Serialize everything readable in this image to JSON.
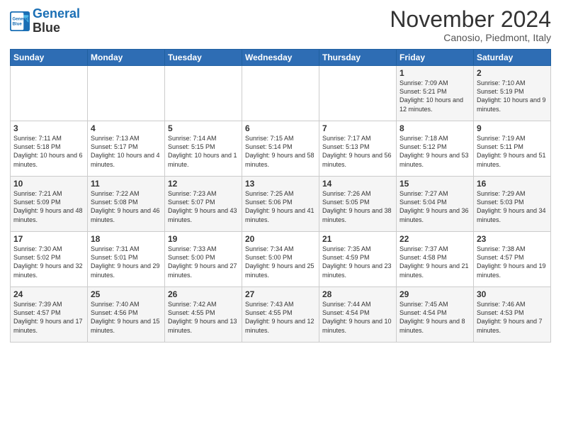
{
  "logo": {
    "line1": "General",
    "line2": "Blue"
  },
  "title": "November 2024",
  "subtitle": "Canosio, Piedmont, Italy",
  "days_of_week": [
    "Sunday",
    "Monday",
    "Tuesday",
    "Wednesday",
    "Thursday",
    "Friday",
    "Saturday"
  ],
  "weeks": [
    [
      {
        "day": "",
        "info": ""
      },
      {
        "day": "",
        "info": ""
      },
      {
        "day": "",
        "info": ""
      },
      {
        "day": "",
        "info": ""
      },
      {
        "day": "",
        "info": ""
      },
      {
        "day": "1",
        "info": "Sunrise: 7:09 AM\nSunset: 5:21 PM\nDaylight: 10 hours and 12 minutes."
      },
      {
        "day": "2",
        "info": "Sunrise: 7:10 AM\nSunset: 5:19 PM\nDaylight: 10 hours and 9 minutes."
      }
    ],
    [
      {
        "day": "3",
        "info": "Sunrise: 7:11 AM\nSunset: 5:18 PM\nDaylight: 10 hours and 6 minutes."
      },
      {
        "day": "4",
        "info": "Sunrise: 7:13 AM\nSunset: 5:17 PM\nDaylight: 10 hours and 4 minutes."
      },
      {
        "day": "5",
        "info": "Sunrise: 7:14 AM\nSunset: 5:15 PM\nDaylight: 10 hours and 1 minute."
      },
      {
        "day": "6",
        "info": "Sunrise: 7:15 AM\nSunset: 5:14 PM\nDaylight: 9 hours and 58 minutes."
      },
      {
        "day": "7",
        "info": "Sunrise: 7:17 AM\nSunset: 5:13 PM\nDaylight: 9 hours and 56 minutes."
      },
      {
        "day": "8",
        "info": "Sunrise: 7:18 AM\nSunset: 5:12 PM\nDaylight: 9 hours and 53 minutes."
      },
      {
        "day": "9",
        "info": "Sunrise: 7:19 AM\nSunset: 5:11 PM\nDaylight: 9 hours and 51 minutes."
      }
    ],
    [
      {
        "day": "10",
        "info": "Sunrise: 7:21 AM\nSunset: 5:09 PM\nDaylight: 9 hours and 48 minutes."
      },
      {
        "day": "11",
        "info": "Sunrise: 7:22 AM\nSunset: 5:08 PM\nDaylight: 9 hours and 46 minutes."
      },
      {
        "day": "12",
        "info": "Sunrise: 7:23 AM\nSunset: 5:07 PM\nDaylight: 9 hours and 43 minutes."
      },
      {
        "day": "13",
        "info": "Sunrise: 7:25 AM\nSunset: 5:06 PM\nDaylight: 9 hours and 41 minutes."
      },
      {
        "day": "14",
        "info": "Sunrise: 7:26 AM\nSunset: 5:05 PM\nDaylight: 9 hours and 38 minutes."
      },
      {
        "day": "15",
        "info": "Sunrise: 7:27 AM\nSunset: 5:04 PM\nDaylight: 9 hours and 36 minutes."
      },
      {
        "day": "16",
        "info": "Sunrise: 7:29 AM\nSunset: 5:03 PM\nDaylight: 9 hours and 34 minutes."
      }
    ],
    [
      {
        "day": "17",
        "info": "Sunrise: 7:30 AM\nSunset: 5:02 PM\nDaylight: 9 hours and 32 minutes."
      },
      {
        "day": "18",
        "info": "Sunrise: 7:31 AM\nSunset: 5:01 PM\nDaylight: 9 hours and 29 minutes."
      },
      {
        "day": "19",
        "info": "Sunrise: 7:33 AM\nSunset: 5:00 PM\nDaylight: 9 hours and 27 minutes."
      },
      {
        "day": "20",
        "info": "Sunrise: 7:34 AM\nSunset: 5:00 PM\nDaylight: 9 hours and 25 minutes."
      },
      {
        "day": "21",
        "info": "Sunrise: 7:35 AM\nSunset: 4:59 PM\nDaylight: 9 hours and 23 minutes."
      },
      {
        "day": "22",
        "info": "Sunrise: 7:37 AM\nSunset: 4:58 PM\nDaylight: 9 hours and 21 minutes."
      },
      {
        "day": "23",
        "info": "Sunrise: 7:38 AM\nSunset: 4:57 PM\nDaylight: 9 hours and 19 minutes."
      }
    ],
    [
      {
        "day": "24",
        "info": "Sunrise: 7:39 AM\nSunset: 4:57 PM\nDaylight: 9 hours and 17 minutes."
      },
      {
        "day": "25",
        "info": "Sunrise: 7:40 AM\nSunset: 4:56 PM\nDaylight: 9 hours and 15 minutes."
      },
      {
        "day": "26",
        "info": "Sunrise: 7:42 AM\nSunset: 4:55 PM\nDaylight: 9 hours and 13 minutes."
      },
      {
        "day": "27",
        "info": "Sunrise: 7:43 AM\nSunset: 4:55 PM\nDaylight: 9 hours and 12 minutes."
      },
      {
        "day": "28",
        "info": "Sunrise: 7:44 AM\nSunset: 4:54 PM\nDaylight: 9 hours and 10 minutes."
      },
      {
        "day": "29",
        "info": "Sunrise: 7:45 AM\nSunset: 4:54 PM\nDaylight: 9 hours and 8 minutes."
      },
      {
        "day": "30",
        "info": "Sunrise: 7:46 AM\nSunset: 4:53 PM\nDaylight: 9 hours and 7 minutes."
      }
    ]
  ]
}
